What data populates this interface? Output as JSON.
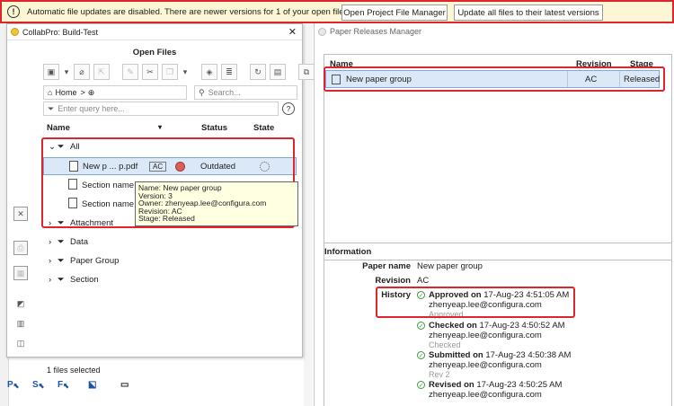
{
  "notification": {
    "icon": "info-exclamation-icon",
    "message": "Automatic file updates are disabled. There are newer versions for 1 of your open files",
    "open_manager_label": "Open Project File Manager",
    "update_all_label": "Update all files to their latest versions"
  },
  "collab": {
    "title": "CollabPro: Build-Test",
    "close": "✕",
    "panel_title": "Open Files",
    "breadcrumb_home": "Home",
    "breadcrumb_sep": ">",
    "breadcrumb_add": "⊕",
    "search_placeholder": "Search...",
    "query_placeholder": "Enter query here...",
    "help": "?",
    "columns": {
      "name": "Name",
      "status": "Status",
      "state": "State"
    },
    "rows": {
      "all": "All",
      "file1": "New p ... p.pdf",
      "file1_badge": "AC",
      "file1_status": "Outdated",
      "file2": "Section name",
      "file3": "Section name 2",
      "attachment": "Attachment",
      "data": "Data",
      "paper_group": "Paper Group",
      "section": "Section"
    },
    "tooltip": {
      "line1": "Name: New paper group",
      "line2": "Version: 3",
      "line3": "Owner: zhenyeap.lee@configura.com",
      "line4": "Revision: AC",
      "line5": "Stage: Released"
    },
    "status_bar": "1 files selected"
  },
  "bottom_icons": [
    "P",
    "S",
    "F"
  ],
  "prm": {
    "title": "Paper Releases Manager",
    "columns": {
      "name": "Name",
      "revision": "Revision",
      "stage": "Stage"
    },
    "row": {
      "name": "New paper group",
      "revision": "AC",
      "stage": "Released"
    },
    "info_title": "Information",
    "paper_name_label": "Paper name",
    "paper_name_value": "New paper group",
    "revision_label": "Revision",
    "revision_value": "AC",
    "history_label": "History",
    "history": [
      {
        "action": "Approved on",
        "time": "17-Aug-23 4:51:05 AM",
        "user": "zhenyeap.lee@configura.com",
        "note": "Approved"
      },
      {
        "action": "Checked on",
        "time": "17-Aug-23 4:50:52 AM",
        "user": "zhenyeap.lee@configura.com",
        "note": "Checked"
      },
      {
        "action": "Submitted on",
        "time": "17-Aug-23 4:50:38 AM",
        "user": "zhenyeap.lee@configura.com",
        "note": "Rev 2"
      },
      {
        "action": "Revised on",
        "time": "17-Aug-23 4:50:25 AM",
        "user": "zhenyeap.lee@configura.com",
        "note": ""
      }
    ]
  },
  "colors": {
    "highlight": "#e0242d",
    "selection": "#dbe8f7",
    "notification_bg": "#fdf6d4"
  }
}
